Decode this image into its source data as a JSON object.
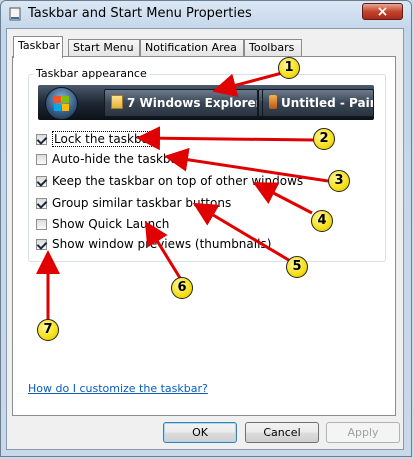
{
  "window": {
    "title": "Taskbar and Start Menu Properties",
    "close_glyph": "×"
  },
  "tabs": [
    {
      "label": "Taskbar",
      "active": true
    },
    {
      "label": "Start Menu",
      "active": false
    },
    {
      "label": "Notification Area",
      "active": false
    },
    {
      "label": "Toolbars",
      "active": false
    }
  ],
  "taskbar_appearance": {
    "group_label": "Taskbar appearance",
    "preview": {
      "button1_count": "7",
      "button1_label": "Windows Explorer",
      "button2_label": "Untitled - Paint"
    },
    "options": [
      {
        "label": "Lock the taskbar",
        "checked": true
      },
      {
        "label": "Auto-hide the taskbar",
        "checked": false
      },
      {
        "label": "Keep the taskbar on top of other windows",
        "checked": true
      },
      {
        "label": "Group similar taskbar buttons",
        "checked": true
      },
      {
        "label": "Show Quick Launch",
        "checked": false
      },
      {
        "label": "Show window previews (thumbnails)",
        "checked": true
      }
    ]
  },
  "help_link": "How do I customize the taskbar?",
  "buttons": {
    "ok": "OK",
    "cancel": "Cancel",
    "apply": "Apply"
  },
  "callouts": [
    "1",
    "2",
    "3",
    "4",
    "5",
    "6",
    "7"
  ],
  "colors": {
    "arrow": "#e00000",
    "badge": "#f5df14",
    "link": "#0b5bbd"
  }
}
